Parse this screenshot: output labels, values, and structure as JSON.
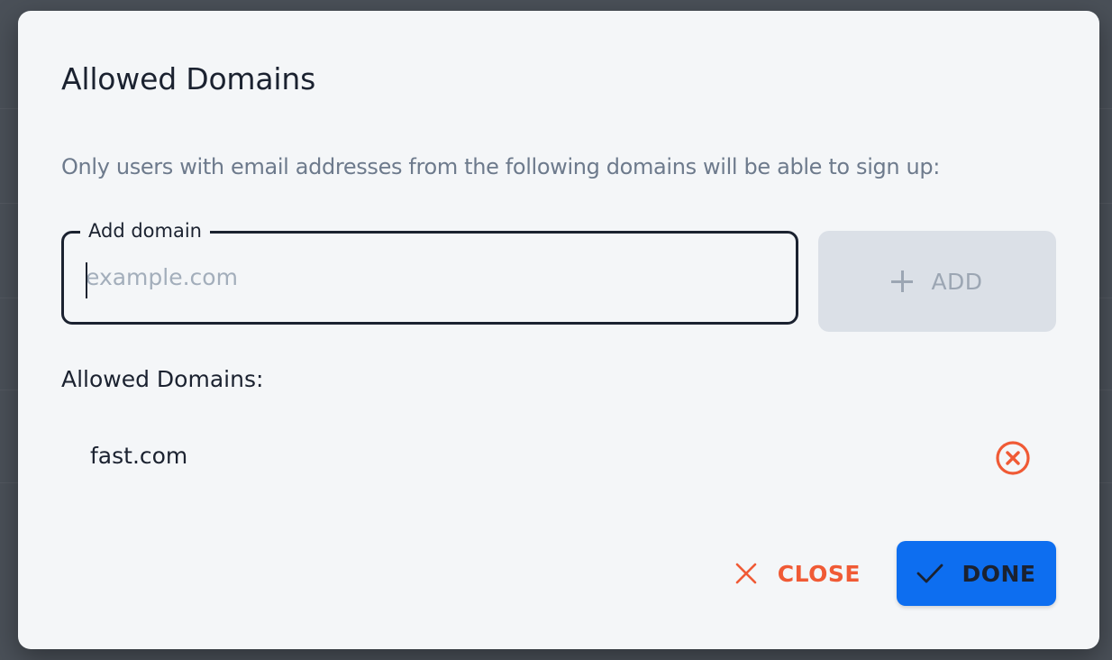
{
  "dialog": {
    "title": "Allowed Domains",
    "description": "Only users with email addresses from the following domains will be able to sign up:"
  },
  "add_domain": {
    "label": "Add domain",
    "value": "",
    "placeholder": "example.com",
    "add_button": {
      "label": "ADD",
      "icon": "plus-icon",
      "state": "disabled"
    }
  },
  "allowed_list": {
    "heading": "Allowed Domains:",
    "items": [
      {
        "domain": "fast.com",
        "remove_icon": "remove-circle-x-icon"
      }
    ]
  },
  "actions": {
    "close_label": "CLOSE",
    "close_icon": "close-x-icon",
    "done_label": "DONE",
    "done_icon": "check-icon"
  },
  "colors": {
    "primary": "#0d6ef0",
    "danger": "#f05a35",
    "text": "#1b2230",
    "muted": "#6d7a8c",
    "disabled_bg": "#dbe0e7",
    "dialog_bg": "#f4f6f8"
  }
}
